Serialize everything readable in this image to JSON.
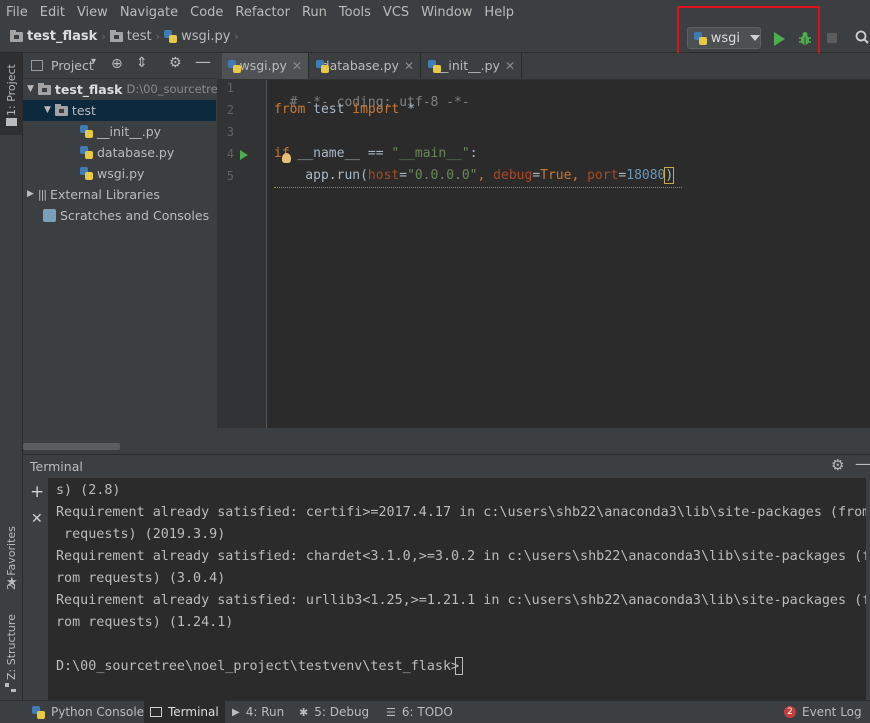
{
  "menu": [
    "File",
    "Edit",
    "View",
    "Navigate",
    "Code",
    "Refactor",
    "Run",
    "Tools",
    "VCS",
    "Window",
    "Help"
  ],
  "breadcrumb": [
    "test_flask",
    "test",
    "wsgi.py"
  ],
  "run_config": {
    "label": "wsgi"
  },
  "side_tabs": {
    "project": "1: Project",
    "favorites": "2: Favorites",
    "structure": "Z: Structure"
  },
  "project_panel": {
    "title": "Project",
    "tree": [
      {
        "label": "test_flask",
        "path": "D:\\00_sourcetree"
      },
      {
        "label": "test"
      },
      {
        "label": "__init__.py"
      },
      {
        "label": "database.py"
      },
      {
        "label": "wsgi.py"
      },
      {
        "label": "External Libraries"
      },
      {
        "label": "Scratches and Consoles"
      }
    ]
  },
  "editor": {
    "tabs": [
      "wsgi.py",
      "database.py",
      "__init__.py"
    ],
    "line_numbers": [
      "1",
      "2",
      "3",
      "4",
      "5"
    ],
    "lines": {
      "l1": "# -*- coding: utf-8 -*-",
      "l2_kw1": "from",
      "l2_mod": " test ",
      "l2_kw2": "import",
      "l2_rest": " *",
      "l4_kw": "if",
      "l4_a": " __name__ == ",
      "l4_str": "\"__main__\"",
      "l4_colon": ":",
      "l5_a": "    app.run(",
      "l5_p1": "host",
      "l5_eq1": "=",
      "l5_s1": "\"0.0.0.0\"",
      "l5_c1": ", ",
      "l5_p2": "debug",
      "l5_eq2": "=",
      "l5_v2": "True",
      "l5_c2": ", ",
      "l5_p3": "port",
      "l5_eq3": "=",
      "l5_v3": "18080",
      "l5_end": ")"
    }
  },
  "terminal": {
    "title": "Terminal",
    "lines": [
      "s) (2.8)",
      "Requirement already satisfied: certifi>=2017.4.17 in c:\\users\\shb22\\anaconda3\\lib\\site-packages (from",
      " requests) (2019.3.9)",
      "Requirement already satisfied: chardet<3.1.0,>=3.0.2 in c:\\users\\shb22\\anaconda3\\lib\\site-packages (f",
      "rom requests) (3.0.4)",
      "Requirement already satisfied: urllib3<1.25,>=1.21.1 in c:\\users\\shb22\\anaconda3\\lib\\site-packages (f",
      "rom requests) (1.24.1)",
      "",
      "D:\\00_sourcetree\\noel_project\\testvenv\\test_flask>"
    ]
  },
  "bottom_tabs": {
    "python_console": "Python Console",
    "terminal": "Terminal",
    "run": "4: Run",
    "debug": "5: Debug",
    "todo": "6: TODO",
    "event_log": "Event Log",
    "event_count": "2"
  },
  "colors": {
    "accent_red": "#e0101a",
    "run_green": "#4cae4f",
    "selection": "#0d293e"
  }
}
